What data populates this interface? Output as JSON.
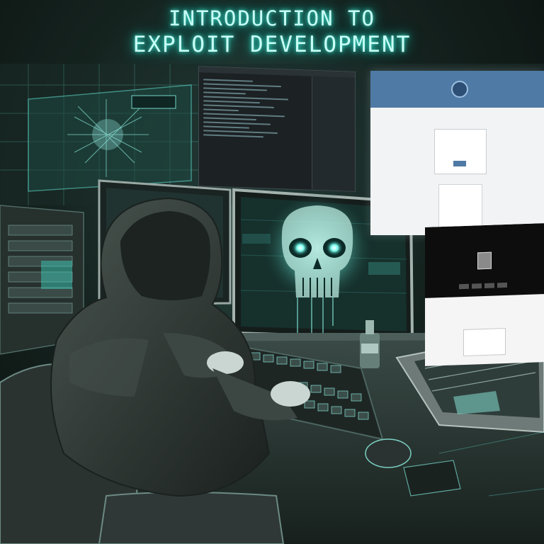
{
  "title": {
    "line1": "INTRODUCTION TO",
    "line2": "EXPLOIT DEVELOPMENT"
  },
  "colors": {
    "glow": "#3fe6d2",
    "background": "#0b1110",
    "accent_blue": "#4f7aa5"
  }
}
